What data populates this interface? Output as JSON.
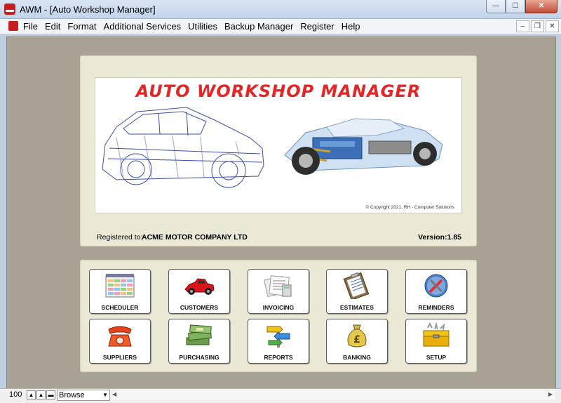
{
  "window": {
    "title": "AWM - [Auto Workshop Manager]",
    "minimize": "—",
    "maximize": "☐",
    "close": "✕"
  },
  "menu": {
    "items": [
      "File",
      "Edit",
      "Format",
      "Additional Services",
      "Utilities",
      "Backup Manager",
      "Register",
      "Help"
    ],
    "mdi_minimize": "–",
    "mdi_restore": "❐",
    "mdi_close": "✕"
  },
  "banner": {
    "title": "AUTO WORKSHOP MANAGER",
    "copyright": "© Copyright 2021, RH - Computer Solutions",
    "registered_label": "Registered to:",
    "registered_to": "ACME MOTOR COMPANY LTD",
    "version": "Version:1.85"
  },
  "tiles": [
    {
      "label": "SCHEDULER",
      "icon": "scheduler-icon"
    },
    {
      "label": "CUSTOMERS",
      "icon": "red-car-icon"
    },
    {
      "label": "INVOICING",
      "icon": "invoice-papers-icon"
    },
    {
      "label": "ESTIMATES",
      "icon": "clipboard-icon"
    },
    {
      "label": "REMINDERS",
      "icon": "tools-globe-icon"
    },
    {
      "label": "SUPPLIERS",
      "icon": "telephone-icon"
    },
    {
      "label": "PURCHASING",
      "icon": "money-stack-icon"
    },
    {
      "label": "REPORTS",
      "icon": "signpost-icon"
    },
    {
      "label": "BANKING",
      "icon": "money-bag-icon"
    },
    {
      "label": "SETUP",
      "icon": "toolbox-icon"
    }
  ],
  "statusbar": {
    "zoom": "100",
    "mode": "Browse"
  },
  "colors": {
    "client_bg": "#a8a394",
    "panel_bg": "#ebe8d6",
    "title_red": "#e32626"
  }
}
